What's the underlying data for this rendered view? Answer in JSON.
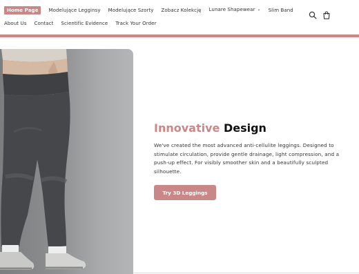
{
  "nav": {
    "row1": [
      {
        "label": "Home Page",
        "active": true
      },
      {
        "label": "Modelujące Legginsy"
      },
      {
        "label": "Modelujące Szorty"
      },
      {
        "label": "Zobacz Kolekcję"
      },
      {
        "label": "Lunare Shapewear"
      },
      {
        "label": "Slim Band"
      }
    ],
    "row2": [
      {
        "label": "About Us"
      },
      {
        "label": "Contact"
      },
      {
        "label": "Scientific Evidence"
      },
      {
        "label": "Track Your Order"
      }
    ],
    "chevron": "⌄"
  },
  "icons": {
    "search": "search-icon",
    "cart": "shopping-bag-icon"
  },
  "hero": {
    "title_accent": "Innovative",
    "title_rest": "Design",
    "description": "We've created the most advanced anti-cellulite leggings. Designed to stimulate circulation, provide gentle drainage, light compression, and a push-up effect. For visibly smoother skin and a beautifully sculpted silhouette.",
    "cta_label": "Try 3D Leggings"
  },
  "colors": {
    "accent": "#c98788",
    "text": "#222222"
  }
}
